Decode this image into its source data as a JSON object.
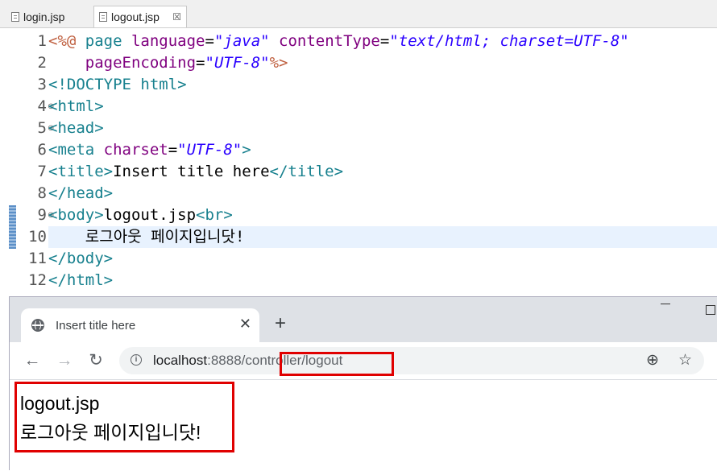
{
  "editor": {
    "tabs": [
      {
        "label": "login.jsp",
        "active": false
      },
      {
        "label": "logout.jsp",
        "active": true,
        "close": "☒"
      }
    ],
    "lines": [
      {
        "num": "1",
        "fold": ""
      },
      {
        "num": "2",
        "fold": ""
      },
      {
        "num": "3",
        "fold": ""
      },
      {
        "num": "4",
        "fold": "⊖"
      },
      {
        "num": "5",
        "fold": "⊖"
      },
      {
        "num": "6",
        "fold": ""
      },
      {
        "num": "7",
        "fold": ""
      },
      {
        "num": "8",
        "fold": ""
      },
      {
        "num": "9",
        "fold": "⊖"
      },
      {
        "num": "10",
        "fold": ""
      },
      {
        "num": "11",
        "fold": ""
      },
      {
        "num": "12",
        "fold": ""
      }
    ],
    "code": {
      "l1": {
        "open": "<%@",
        "kw": " page ",
        "a1": "language",
        "eq": "=",
        "v1": "\"java\"",
        "a2": " contentType",
        "v2": "\"text/html; charset=UTF-8\""
      },
      "l2": {
        "indent": "    ",
        "a": "pageEncoding",
        "eq": "=",
        "v": "\"UTF-8\"",
        "close": "%>"
      },
      "l3": {
        "text": "<!DOCTYPE html>"
      },
      "l4": {
        "text": "<html>"
      },
      "l5": {
        "text": "<head>"
      },
      "l6": {
        "tag": "<meta",
        "a": " charset",
        "eq": "=",
        "v": "\"UTF-8\"",
        "close": ">"
      },
      "l7": {
        "open": "<title>",
        "text": "Insert title here",
        "close": "</title>"
      },
      "l8": {
        "text": "</head>"
      },
      "l9": {
        "open": "<body>",
        "text": "logout.jsp",
        "br": "<br>"
      },
      "l10": {
        "text": "    로그아웃 페이지입니닷!"
      },
      "l11": {
        "text": "</body>"
      },
      "l12": {
        "text": "</html>"
      }
    }
  },
  "browser": {
    "tab_title": "Insert title here",
    "tab_close": "✕",
    "new_tab": "+",
    "nav": {
      "back": "←",
      "forward": "→",
      "reload": "↻"
    },
    "url": {
      "host": "localhost",
      "port": ":8888",
      "path": "/controller/logout"
    },
    "zoom_icon": "⊕",
    "star_icon": "☆",
    "content": {
      "line1": "logout.jsp",
      "line2": "로그아웃 페이지입니닷!"
    },
    "highlight_color": "#e00000"
  }
}
